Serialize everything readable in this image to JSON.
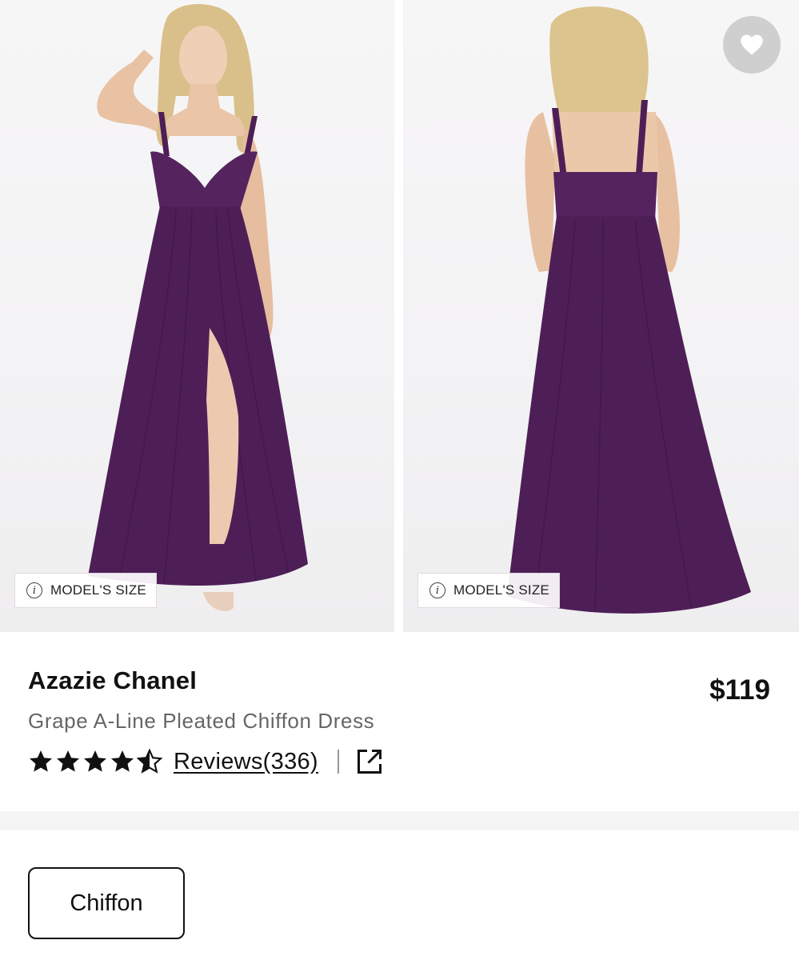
{
  "gallery": {
    "model_size_label_front": "MODEL'S SIZE",
    "model_size_label_back": "MODEL'S SIZE",
    "info_icon_glyph": "i"
  },
  "product": {
    "title": "Azazie Chanel",
    "subtitle": "Grape A-Line Pleated Chiffon Dress",
    "price": "$119",
    "rating": 4.5,
    "reviews_label": "Reviews(336)"
  },
  "fabric": {
    "selected": "Chiffon"
  },
  "colors": {
    "dress": "#4e1f57",
    "wishlist_bg": "#cfcfcf",
    "text_primary": "#111111",
    "text_secondary": "#666666"
  },
  "icons": {
    "wishlist": "heart-icon",
    "share": "external-link-icon",
    "info": "info-icon",
    "star": "star-icon"
  }
}
